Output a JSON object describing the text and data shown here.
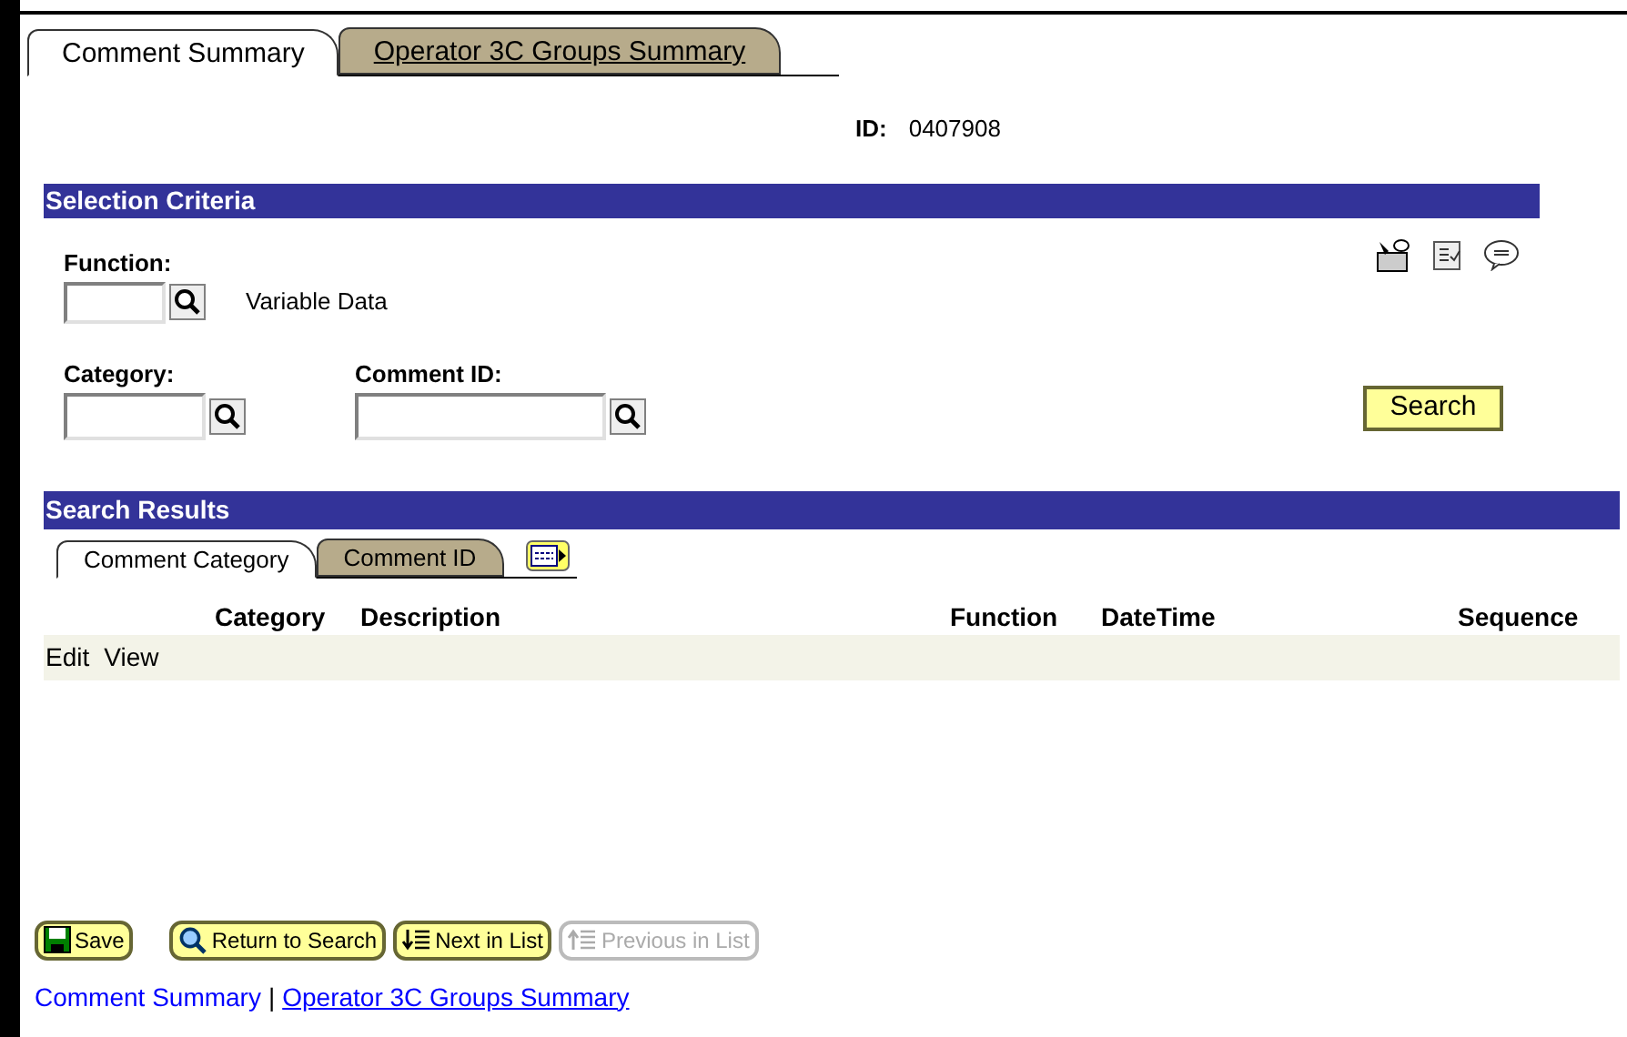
{
  "tabs": [
    {
      "label": "Comment Summary",
      "selected": true
    },
    {
      "label": "Operator 3C Groups Summary",
      "selected": false
    }
  ],
  "id_field": {
    "label": "ID:",
    "value": "0407908"
  },
  "selection_criteria": {
    "title": "Selection Criteria",
    "function": {
      "label": "Function:",
      "description": "Variable Data"
    },
    "category": {
      "label": "Category:"
    },
    "comment_id": {
      "label": "Comment ID:"
    },
    "search_button": "Search"
  },
  "search_results": {
    "title": "Search Results",
    "tabs": [
      {
        "label": "Comment Category",
        "selected": true
      },
      {
        "label": "Comment ID",
        "selected": false
      }
    ],
    "columns": [
      "Category",
      "Description",
      "Function",
      "DateTime",
      "Sequence"
    ],
    "row_links": [
      "Edit",
      "View"
    ]
  },
  "toolbar": [
    {
      "kind": "save",
      "label": "Save",
      "disabled": false
    },
    {
      "kind": "return",
      "label": "Return to Search",
      "disabled": false
    },
    {
      "kind": "next",
      "label": "Next in List",
      "disabled": false
    },
    {
      "kind": "previous",
      "label": "Previous in List",
      "disabled": true
    }
  ],
  "page_link_separator": "|",
  "page_links": [
    {
      "label": "Comment Summary",
      "selected": true
    },
    {
      "label": "Operator 3C Groups Summary",
      "selected": false
    }
  ]
}
